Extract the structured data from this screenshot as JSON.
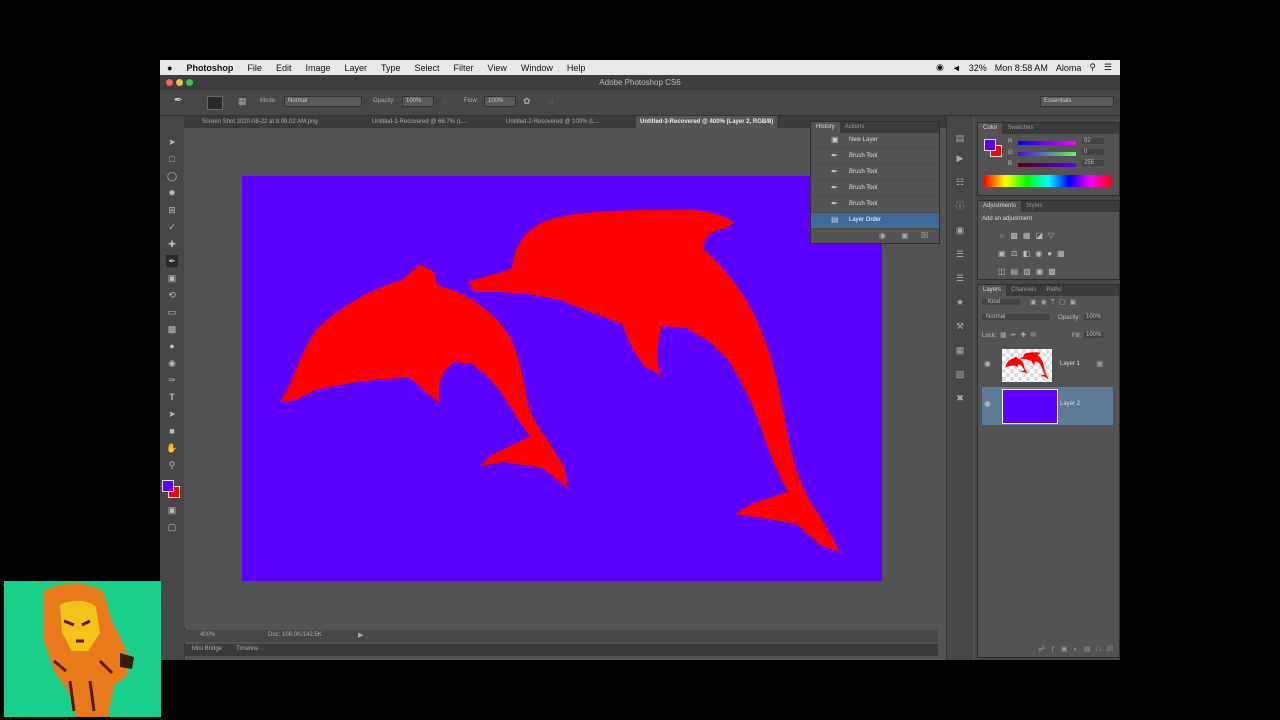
{
  "menubar": {
    "apple": "",
    "app": "Photoshop",
    "items": [
      "File",
      "Edit",
      "Image",
      "Layer",
      "Type",
      "Select",
      "Filter",
      "View",
      "Window",
      "Help"
    ],
    "status": {
      "battery": "32%",
      "clock": "Mon 8:58 AM",
      "user": "Aloma"
    }
  },
  "titlebar": {
    "title": "Adobe Photoshop CS6"
  },
  "options": {
    "mode_label": "Mode:",
    "mode_value": "Normal",
    "opacity_label": "Opacity:",
    "opacity_value": "100%",
    "flow_label": "Flow:",
    "flow_value": "100%",
    "workspace": "Essentials"
  },
  "tabs": [
    {
      "label": "Screen Shot 2020-08-22 at 8.09.02 AM.png",
      "active": false
    },
    {
      "label": "Untitled-1-Recovered @ 66.7% (L...",
      "active": false
    },
    {
      "label": "Untitled-2-Recovered @ 100% (L...",
      "active": false
    },
    {
      "label": "Untitled-3-Recovered @ 400% (Layer 2, RGB/8)",
      "active": true
    }
  ],
  "status": {
    "zoom": "400%",
    "doc": "Doc: 108.0K/142.5K"
  },
  "bottom_tabs": [
    "Mini Bridge",
    "Timeline"
  ],
  "history_panel": {
    "tabs": [
      "History",
      "Actions"
    ],
    "rows": [
      {
        "label": "New Layer",
        "selected": false
      },
      {
        "label": "Brush Tool",
        "selected": false
      },
      {
        "label": "Brush Tool",
        "selected": false
      },
      {
        "label": "Brush Tool",
        "selected": false
      },
      {
        "label": "Brush Tool",
        "selected": false
      },
      {
        "label": "Layer Order",
        "selected": true
      }
    ]
  },
  "color_panel": {
    "tabs": [
      "Color",
      "Swatches"
    ],
    "r": "R",
    "g": "G",
    "b": "B",
    "r_value": "92",
    "g_value": "0",
    "b_value": "255"
  },
  "adjustments_panel": {
    "tabs": [
      "Adjustments",
      "Styles"
    ],
    "heading": "Add an adjustment"
  },
  "layers_panel": {
    "tabs": [
      "Layers",
      "Channels",
      "Paths"
    ],
    "kind": "Kind",
    "blend": "Normal",
    "opacity_label": "Opacity:",
    "opacity_value": "100%",
    "lock_label": "Lock:",
    "fill_label": "Fill:",
    "fill_value": "100%",
    "layers": [
      {
        "name": "Layer 1",
        "selected": false
      },
      {
        "name": "Layer 2",
        "selected": true
      }
    ]
  },
  "colors": {
    "canvas": "#5b00ff",
    "dolphin": "#ff0000",
    "foreground": "#5b00ff",
    "background": "#ff0000",
    "webcam_bg": "#19d08a"
  }
}
